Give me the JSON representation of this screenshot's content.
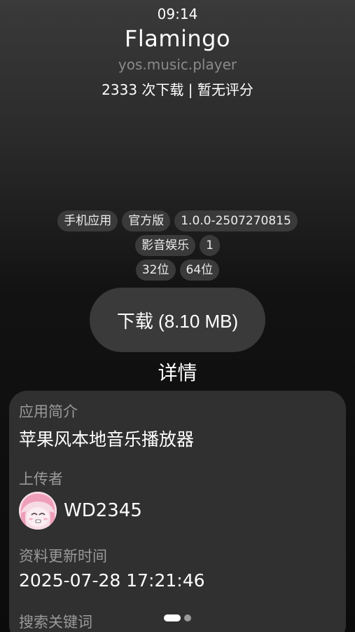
{
  "status_bar": {
    "time": "09:14"
  },
  "app": {
    "name": "Flamingo",
    "package": "yos.music.player",
    "stats": "2333 次下载 | 暂无评分"
  },
  "tags": {
    "row1": [
      "手机应用",
      "官方版",
      "1.0.0-2507270815"
    ],
    "row2": [
      "影音娱乐",
      "1"
    ],
    "row3": [
      "32位",
      "64位"
    ]
  },
  "download": {
    "label": "下载 (8.10 MB)"
  },
  "details": {
    "heading": "详情",
    "desc_label": "应用简介",
    "desc_value": "苹果风本地音乐播放器",
    "uploader_label": "上传者",
    "uploader_name": "WD2345",
    "updated_label": "资料更新时间",
    "updated_value": "2025-07-28 17:21:46",
    "keywords_label": "搜索关键词"
  },
  "pager": {
    "pages": 2,
    "current": 1
  }
}
